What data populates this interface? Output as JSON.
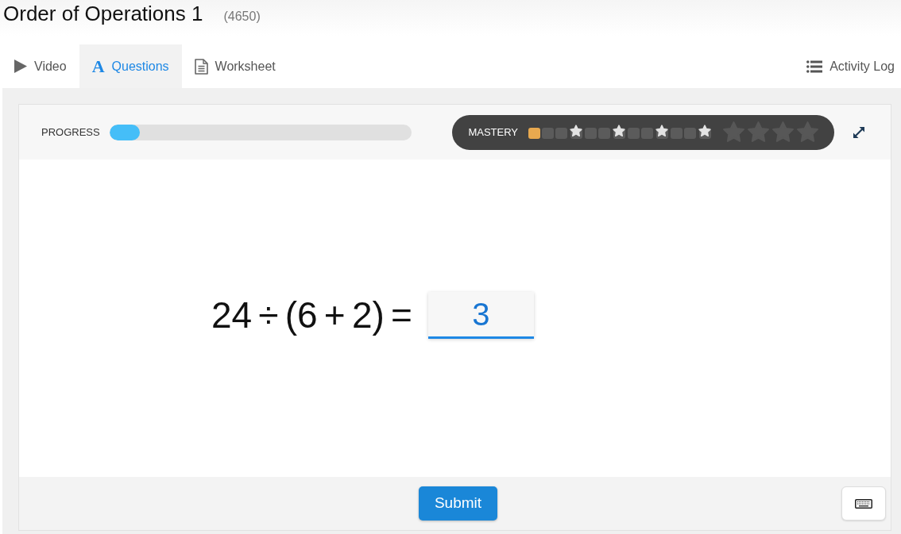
{
  "header": {
    "title": "Order of Operations 1",
    "code": "(4650)"
  },
  "tabs": [
    {
      "kind": "video",
      "label": "Video",
      "selected": false
    },
    {
      "kind": "questions",
      "glyph": "A",
      "label": "Questions",
      "selected": true
    },
    {
      "kind": "worksheet",
      "label": "Worksheet",
      "selected": false
    }
  ],
  "activity_log": {
    "label": "Activity Log"
  },
  "progress": {
    "label": "PROGRESS",
    "level": 0.1
  },
  "mastery": {
    "label": "MASTERY",
    "steps": [
      {
        "kind": "square",
        "filled": true
      },
      {
        "kind": "square",
        "filled": false
      },
      {
        "kind": "square",
        "filled": false
      },
      {
        "kind": "milestone",
        "filled": false
      },
      {
        "kind": "square",
        "filled": false
      },
      {
        "kind": "square",
        "filled": false
      },
      {
        "kind": "milestone",
        "filled": false
      },
      {
        "kind": "square",
        "filled": false
      },
      {
        "kind": "square",
        "filled": false
      },
      {
        "kind": "milestone",
        "filled": false
      },
      {
        "kind": "square",
        "filled": false
      },
      {
        "kind": "square",
        "filled": false
      },
      {
        "kind": "milestone",
        "filled": false
      }
    ],
    "stars": 0
  },
  "question": {
    "expression": "24 ÷ (6 + 2) =",
    "answer": "3"
  },
  "submit": {
    "label": "Submit"
  }
}
